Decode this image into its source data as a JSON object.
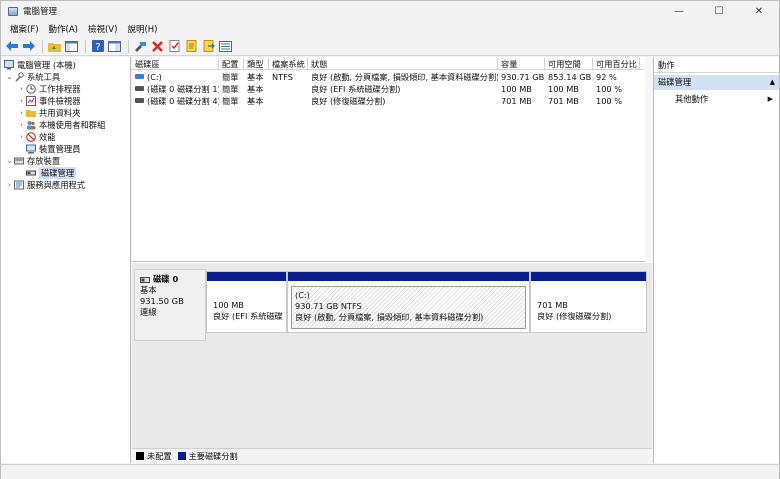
{
  "window": {
    "title": "電腦管理",
    "minimize_glyph": "—",
    "maximize_glyph": "☐",
    "close_glyph": "✕"
  },
  "menu": [
    "檔案(F)",
    "動作(A)",
    "檢視(V)",
    "說明(H)"
  ],
  "toolbar": {
    "icons": [
      "back-arrow-icon",
      "forward-arrow-icon",
      "up-folder-icon",
      "show-hide-tree-icon",
      "help-icon",
      "console-icon",
      "connect-icon",
      "delete-icon",
      "check-icon",
      "properties-icon",
      "export-icon",
      "view-icon"
    ]
  },
  "tree": {
    "root": "電腦管理 (本機)",
    "system_tools": "系統工具",
    "task_scheduler": "工作排程器",
    "event_viewer": "事件檢視器",
    "shared_folders": "共用資料夾",
    "local_users": "本機使用者和群組",
    "performance": "效能",
    "device_manager": "裝置管理員",
    "storage": "存放裝置",
    "disk_management": "磁碟管理",
    "services": "服務與應用程式"
  },
  "volumes": {
    "headers": [
      "磁碟區",
      "配置",
      "類型",
      "檔案系統",
      "狀態",
      "容量",
      "可用空間",
      "可用百分比"
    ],
    "rows": [
      {
        "name": "(C:)",
        "layout": "簡單",
        "type": "基本",
        "fs": "NTFS",
        "status": "良好 (啟動, 分頁檔案, 損毀傾印, 基本資料磁碟分割)",
        "capacity": "930.71 GB",
        "free": "853.14 GB",
        "pct": "92 %"
      },
      {
        "name": "(磁碟 0 磁碟分割 1)",
        "layout": "簡單",
        "type": "基本",
        "fs": "",
        "status": "良好 (EFI 系統磁碟分割)",
        "capacity": "100 MB",
        "free": "100 MB",
        "pct": "100 %"
      },
      {
        "name": "(磁碟 0 磁碟分割 4)",
        "layout": "簡單",
        "type": "基本",
        "fs": "",
        "status": "良好 (修復磁碟分割)",
        "capacity": "701 MB",
        "free": "701 MB",
        "pct": "100 %"
      }
    ]
  },
  "disk": {
    "name": "磁碟 0",
    "type": "基本",
    "size": "931.50 GB",
    "state": "連線",
    "partitions": [
      {
        "line1": "",
        "line2": "100 MB",
        "line3": "良好 (EFI 系統磁碟分割)"
      },
      {
        "line1": "(C:)",
        "line2": "930.71 GB NTFS",
        "line3": "良好 (啟動, 分頁檔案, 損毀傾印, 基本資料磁碟分割)"
      },
      {
        "line1": "",
        "line2": "701 MB",
        "line3": "良好 (修復磁碟分割)"
      }
    ]
  },
  "legend": {
    "unallocated": "未配置",
    "primary": "主要磁碟分割",
    "unallocated_color": "#000000",
    "primary_color": "#0a1f8c"
  },
  "actions": {
    "header": "動作",
    "section": "磁碟管理",
    "more": "其他動作"
  }
}
